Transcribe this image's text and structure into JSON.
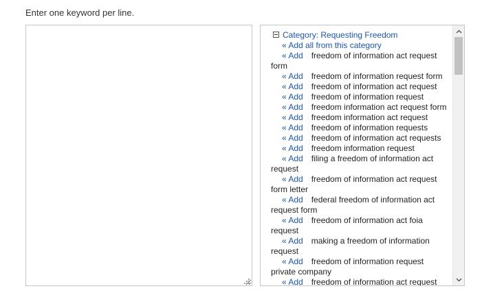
{
  "instructions": "Enter one keyword per line.",
  "keyword_input": {
    "value": "",
    "placeholder": ""
  },
  "suggestions": {
    "category_title": "Category: Requesting Freedom",
    "add_all_label": "« Add all from this category",
    "add_label": "« Add",
    "keywords": [
      "freedom of information act request form",
      "freedom of information request form",
      "freedom of information act request",
      "freedom of information request",
      "freedom information act request form",
      "freedom information act request",
      "freedom of information requests",
      "freedom of information act requests",
      "freedom information request",
      "filing a freedom of information act request",
      "freedom of information act request form letter",
      "federal freedom of information act request form",
      "freedom of information act foia request",
      "making a freedom of information request",
      "freedom of information request private company",
      "freedom of information act request"
    ]
  },
  "colors": {
    "link": "#1a55b7",
    "text": "#222222",
    "border": "#c6c6c6"
  },
  "icons": {
    "collapse": "minus-square",
    "scroll_up": "chevron-up",
    "scroll_down": "chevron-down",
    "resize": "resize-grip"
  }
}
